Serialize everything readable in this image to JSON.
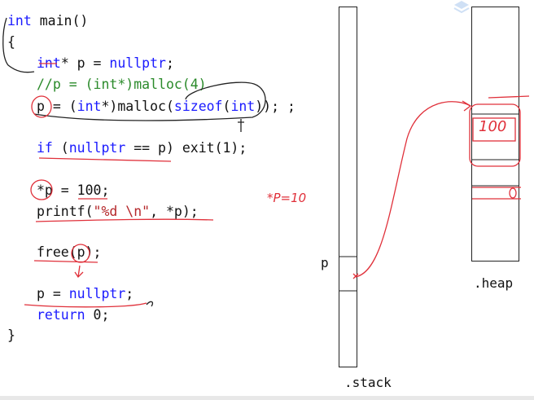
{
  "code": {
    "line1": {
      "kw": "int",
      "rest": " main()"
    },
    "line2": "{",
    "line3": {
      "kw1": "int",
      "mid": "* p = ",
      "kw2": "nullptr",
      "end": ";"
    },
    "line4": "//p = (int*)malloc(4)",
    "line5": {
      "a": "p = (",
      "kw1": "int",
      "b": "*)malloc(",
      "kw2": "sizeof",
      "c": "(",
      "kw3": "int",
      "d": ")); ;"
    },
    "line6": {
      "kw1": "if",
      "a": " (",
      "kw2": "nullptr",
      "b": " == p) exit(1);"
    },
    "line7": "*p = 100;",
    "line8": {
      "a": "printf(",
      "str": "\"%d \\n\"",
      "b": ", *p);"
    },
    "line9": "free(p);",
    "line10": {
      "a": "p = ",
      "kw": "nullptr",
      "b": ";"
    },
    "line11": {
      "kw": "return",
      "b": " 0;"
    },
    "line12": "}"
  },
  "diagram": {
    "pointer_label": "p",
    "stack_label": ".stack",
    "heap_label": ".heap",
    "heap_value": "100",
    "side_note": "*P=10"
  },
  "colors": {
    "keyword": "#1a1aff",
    "comment": "#2a8a2a",
    "string": "#b5282b",
    "annotation_red": "#e0303a",
    "annotation_black": "#222222"
  }
}
